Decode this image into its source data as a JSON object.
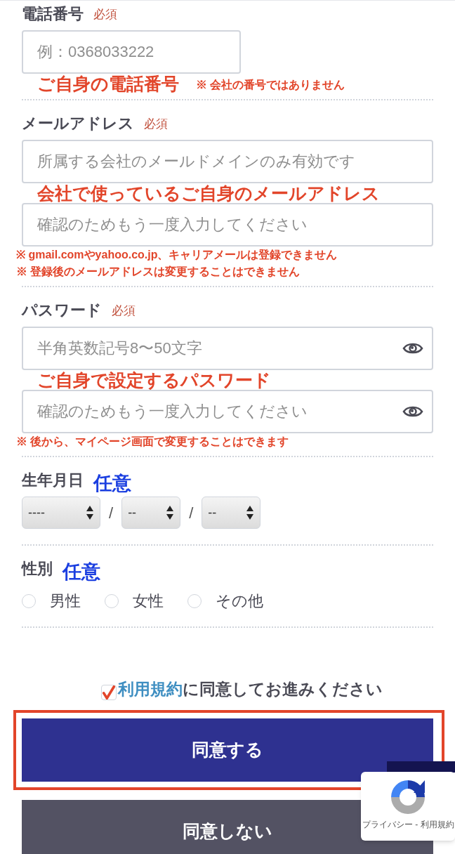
{
  "sections": [
    {
      "label": "電話番号",
      "badge": {
        "text": "必須",
        "required": true
      },
      "rows": [
        {
          "kind": "input",
          "placeholder": "例：0368033222",
          "eye": false,
          "wide": false
        },
        {
          "kind": "annotation",
          "text": "ご自身の電話番号",
          "note": "※ 会社の番号ではありません"
        }
      ]
    },
    {
      "label": "メールアドレス",
      "badge": {
        "text": "必須",
        "required": true
      },
      "rows": [
        {
          "kind": "input",
          "placeholder": "所属する会社のメールドメインのみ有効です",
          "eye": false,
          "wide": true
        },
        {
          "kind": "annotation",
          "text": "会社で使っているご自身のメールアドレス"
        },
        {
          "kind": "input",
          "placeholder": "確認のためもう一度入力してください",
          "eye": false,
          "wide": true
        },
        {
          "kind": "note",
          "text": "※ gmail.comやyahoo.co.jp、キャリアメールは登録できません"
        },
        {
          "kind": "note",
          "text": "※ 登録後のメールアドレスは変更することはできません"
        }
      ]
    },
    {
      "label": "パスワード",
      "badge": {
        "text": "必須",
        "required": true
      },
      "rows": [
        {
          "kind": "input",
          "placeholder": "半角英数記号8〜50文字",
          "eye": true,
          "wide": true
        },
        {
          "kind": "annotation",
          "text": "ご自身で設定するパスワード"
        },
        {
          "kind": "input",
          "placeholder": "確認のためもう一度入力してください",
          "eye": true,
          "wide": true
        },
        {
          "kind": "note",
          "text": "※ 後から、マイページ画面で変更することはできます"
        }
      ]
    },
    {
      "label": "生年月日",
      "badge": {
        "text": "任意",
        "required": false
      },
      "rows": [
        {
          "kind": "selects",
          "selects": [
            "----",
            "--",
            "--"
          ],
          "separators": [
            "/",
            "/"
          ]
        }
      ]
    },
    {
      "label": "性別",
      "badge": {
        "text": "任意",
        "required": false
      },
      "rows": [
        {
          "kind": "radios",
          "options": [
            {
              "label": "男性",
              "selected": false
            },
            {
              "label": "女性",
              "selected": false
            },
            {
              "label": "その他",
              "selected": false
            }
          ]
        }
      ]
    }
  ],
  "terms": {
    "checked": true,
    "link": "利用規約",
    "text": "に同意してお進みください"
  },
  "buttons": [
    {
      "label": "同意する",
      "kind": "primary",
      "highlighted": true
    },
    {
      "label": "同意しない",
      "kind": "secondary"
    }
  ],
  "recaptcha": {
    "text": "プライバシー - 利用規約"
  }
}
